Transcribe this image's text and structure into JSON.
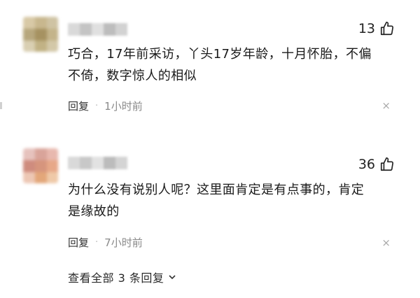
{
  "comments": [
    {
      "likes": "13",
      "text_lines": [
        "巧合，17年前采访，丫头17岁年龄，十月怀胎，不偏",
        "不倚，数字惊人的相似"
      ],
      "reply_label": "回复",
      "separator": "·",
      "time": "1小时前",
      "close": "×",
      "avatar_colors": [
        "#d8c9a6",
        "#c8b78e",
        "#cfc3a3",
        "#b7a77d",
        "#a69261",
        "#c4b48a",
        "#d9cfb2",
        "#c1b285",
        "#d3c8a8"
      ],
      "username_colors": [
        "#d9d9d9",
        "#c4c4c4",
        "#e0e0e0",
        "#bdbdbd",
        "#d2d2d2"
      ]
    },
    {
      "likes": "36",
      "text_lines": [
        "为什么没有说别人呢？这里面肯定是有点事的，肯定",
        "是缘故的"
      ],
      "reply_label": "回复",
      "separator": "·",
      "time": "7小时前",
      "close": "×",
      "avatar_colors": [
        "#e6c2bd",
        "#d9a49a",
        "#e8b8ae",
        "#cf8c7e",
        "#d6957d",
        "#e7a888",
        "#edc7b4",
        "#e3a77a",
        "#efc9a8"
      ],
      "username_colors": [
        "#d9d9d9",
        "#c8c8c8",
        "#e2e2e2",
        "#bcbcbc",
        "#d4d4d4"
      ]
    }
  ],
  "view_all": {
    "label": "查看全部 3 条回复",
    "chevron": "⌄"
  },
  "icons": {
    "like": "thumbs-up-icon",
    "close": "close-icon",
    "expand": "chevron-down-icon"
  }
}
